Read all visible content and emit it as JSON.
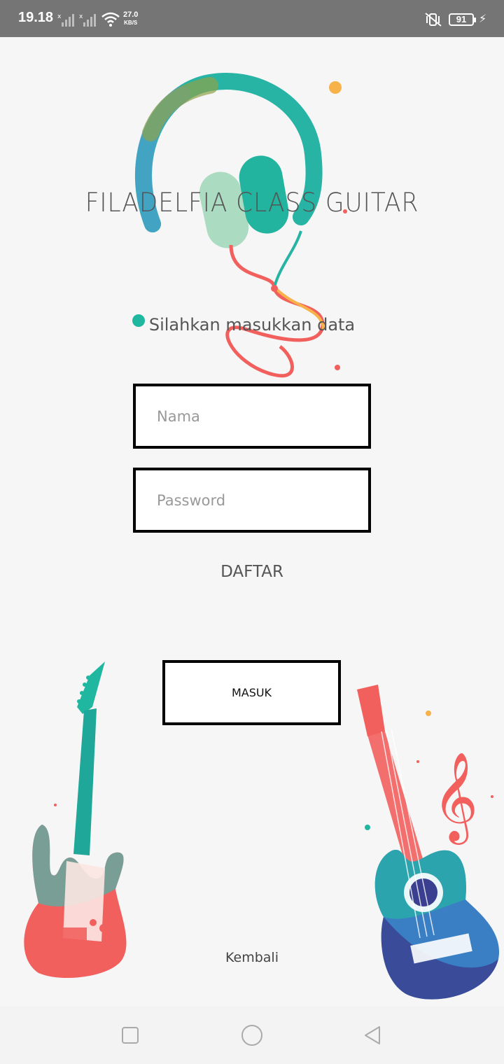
{
  "status_bar": {
    "time": "19.18",
    "network_speed": "27.0",
    "network_unit": "KB/S",
    "battery": "91"
  },
  "app": {
    "title": "FILADELFIA CLASS GUITAR",
    "subtitle": "Silahkan masukkan data"
  },
  "form": {
    "name_placeholder": "Nama",
    "password_placeholder": "Password",
    "register_label": "DAFTAR",
    "login_label": "MASUK",
    "back_label": "Kembali"
  },
  "colors": {
    "teal": "#1fb7a0",
    "coral": "#f2605e",
    "orange": "#f7b24a",
    "navy": "#3a3f8f"
  },
  "nav_bar": {
    "icons": [
      "recent-apps-icon",
      "home-icon",
      "back-icon"
    ]
  }
}
